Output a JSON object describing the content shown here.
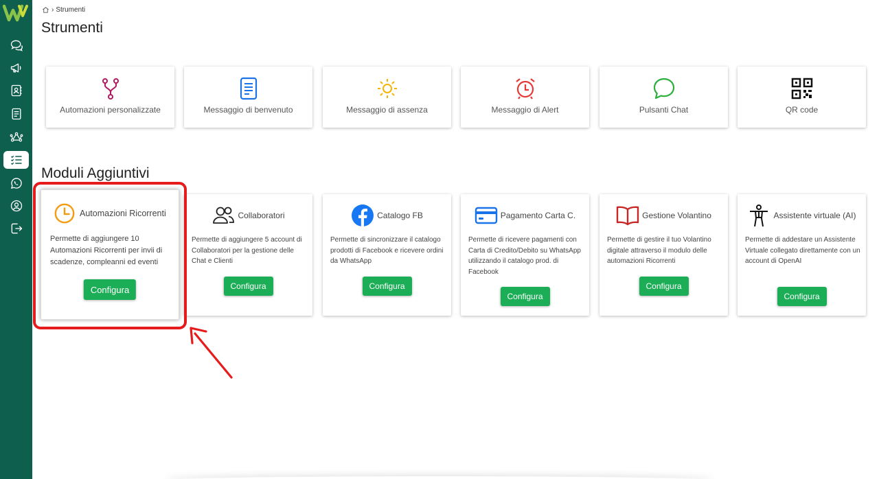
{
  "app": {
    "logo_icon": "app-logo-w",
    "brand_color": "#0e5f4e",
    "accent_color": "#1bae56",
    "highlight_color": "#e61c1c"
  },
  "sidebar": {
    "items": [
      {
        "icon": "chat-bubbles-icon",
        "active": false
      },
      {
        "icon": "megaphone-icon",
        "active": false
      },
      {
        "icon": "contacts-icon",
        "active": false
      },
      {
        "icon": "document-icon",
        "active": false
      },
      {
        "icon": "flow-nodes-icon",
        "active": false
      },
      {
        "icon": "checklist-icon",
        "active": true
      },
      {
        "icon": "whatsapp-icon",
        "active": false
      },
      {
        "icon": "user-circle-icon",
        "active": false
      },
      {
        "icon": "logout-icon",
        "active": false
      }
    ]
  },
  "breadcrumb": {
    "home_icon": "home-icon",
    "current": "Strumenti"
  },
  "page": {
    "title": "Strumenti",
    "section_title": "Moduli Aggiuntivi"
  },
  "tools": [
    {
      "label": "Automazioni personalizzate",
      "icon": "branch-fork-icon"
    },
    {
      "label": "Messaggio di benvenuto",
      "icon": "document-lines-icon"
    },
    {
      "label": "Messaggio di assenza",
      "icon": "sun-icon"
    },
    {
      "label": "Messaggio di Alert",
      "icon": "alarm-clock-icon"
    },
    {
      "label": "Pulsanti Chat",
      "icon": "chat-bubble-icon"
    },
    {
      "label": "QR code",
      "icon": "qr-code-icon"
    }
  ],
  "modules": [
    {
      "title": "Automazioni Ricorrenti",
      "icon": "clock-icon",
      "description": "Permette di aggiungere 10 Automazioni Ricorrenti per invii di scadenze, compleanni ed eventi",
      "button": "Configura"
    },
    {
      "title": "Collaboratori",
      "icon": "users-icon",
      "description": "Permette di aggiungere 5 account di Collaboratori per la gestione delle Chat e Clienti",
      "button": "Configura"
    },
    {
      "title": "Catalogo FB",
      "icon": "facebook-icon",
      "description": "Permette di sincronizzare il catalogo prodotti di Facebook e ricevere ordini da WhatsApp",
      "button": "Configura"
    },
    {
      "title": "Pagamento Carta C.",
      "icon": "credit-card-icon",
      "description": "Permette di ricevere pagamenti con Carta di Credito/Debito su WhatsApp utilizzando il catalogo prod. di Facebook",
      "button": "Configura"
    },
    {
      "title": "Gestione Volantino",
      "icon": "open-book-icon",
      "description": "Permette di gestire il tuo Volantino digitale attraverso il modulo delle automazioni Ricorrenti",
      "button": "Configura"
    },
    {
      "title": "Assistente virtuale (AI)",
      "icon": "accessibility-person-icon",
      "description": "Permette di addestare un Assistente Virtuale collegato direttamente con un account di OpenAI",
      "button": "Configura"
    }
  ]
}
